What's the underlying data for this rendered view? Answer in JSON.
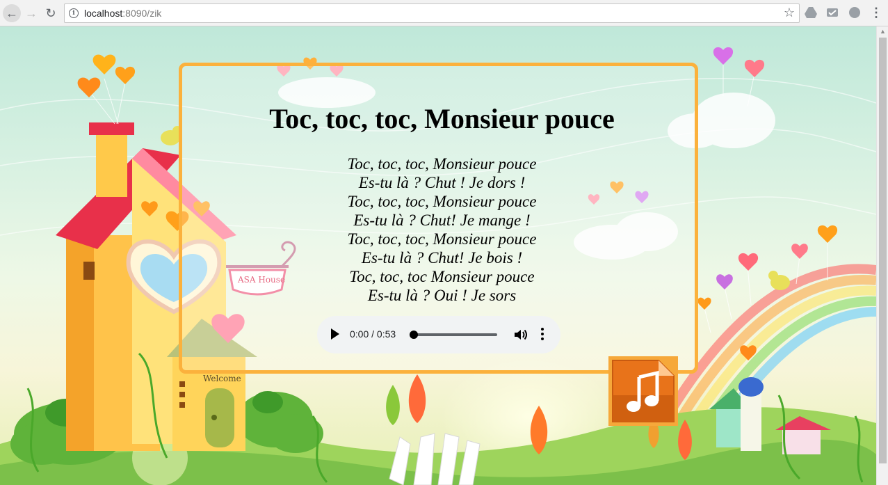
{
  "browser": {
    "url_host": "localhost",
    "url_rest": ":8090/zik",
    "icons": {
      "back": "back-arrow-icon",
      "forward": "forward-arrow-icon",
      "reload": "reload-icon",
      "info": "info-icon",
      "bookmark": "star-icon",
      "ext1": "drive-icon",
      "ext2": "inbox-icon",
      "ext3": "chat-icon",
      "menu": "kebab-menu-icon"
    }
  },
  "song": {
    "title": "Toc, toc, toc, Monsieur pouce",
    "lines": [
      "Toc, toc, toc, Monsieur pouce",
      "Es-tu là ? Chut ! Je dors !",
      "Toc, toc, toc, Monsieur pouce",
      "Es-tu là ? Chut! Je mange !",
      "Toc, toc, toc, Monsieur pouce",
      "Es-tu là ? Chut! Je bois !",
      "Toc, toc, toc Monsieur pouce",
      "Es-tu là ? Oui ! Je sors"
    ]
  },
  "player": {
    "time": "0:00 / 0:53",
    "progress": 0
  },
  "background": {
    "sign_text": "ASA House",
    "door_sign": "Welcome"
  },
  "colors": {
    "card_border": "#fbb13c",
    "music_icon": "#e8731a"
  }
}
